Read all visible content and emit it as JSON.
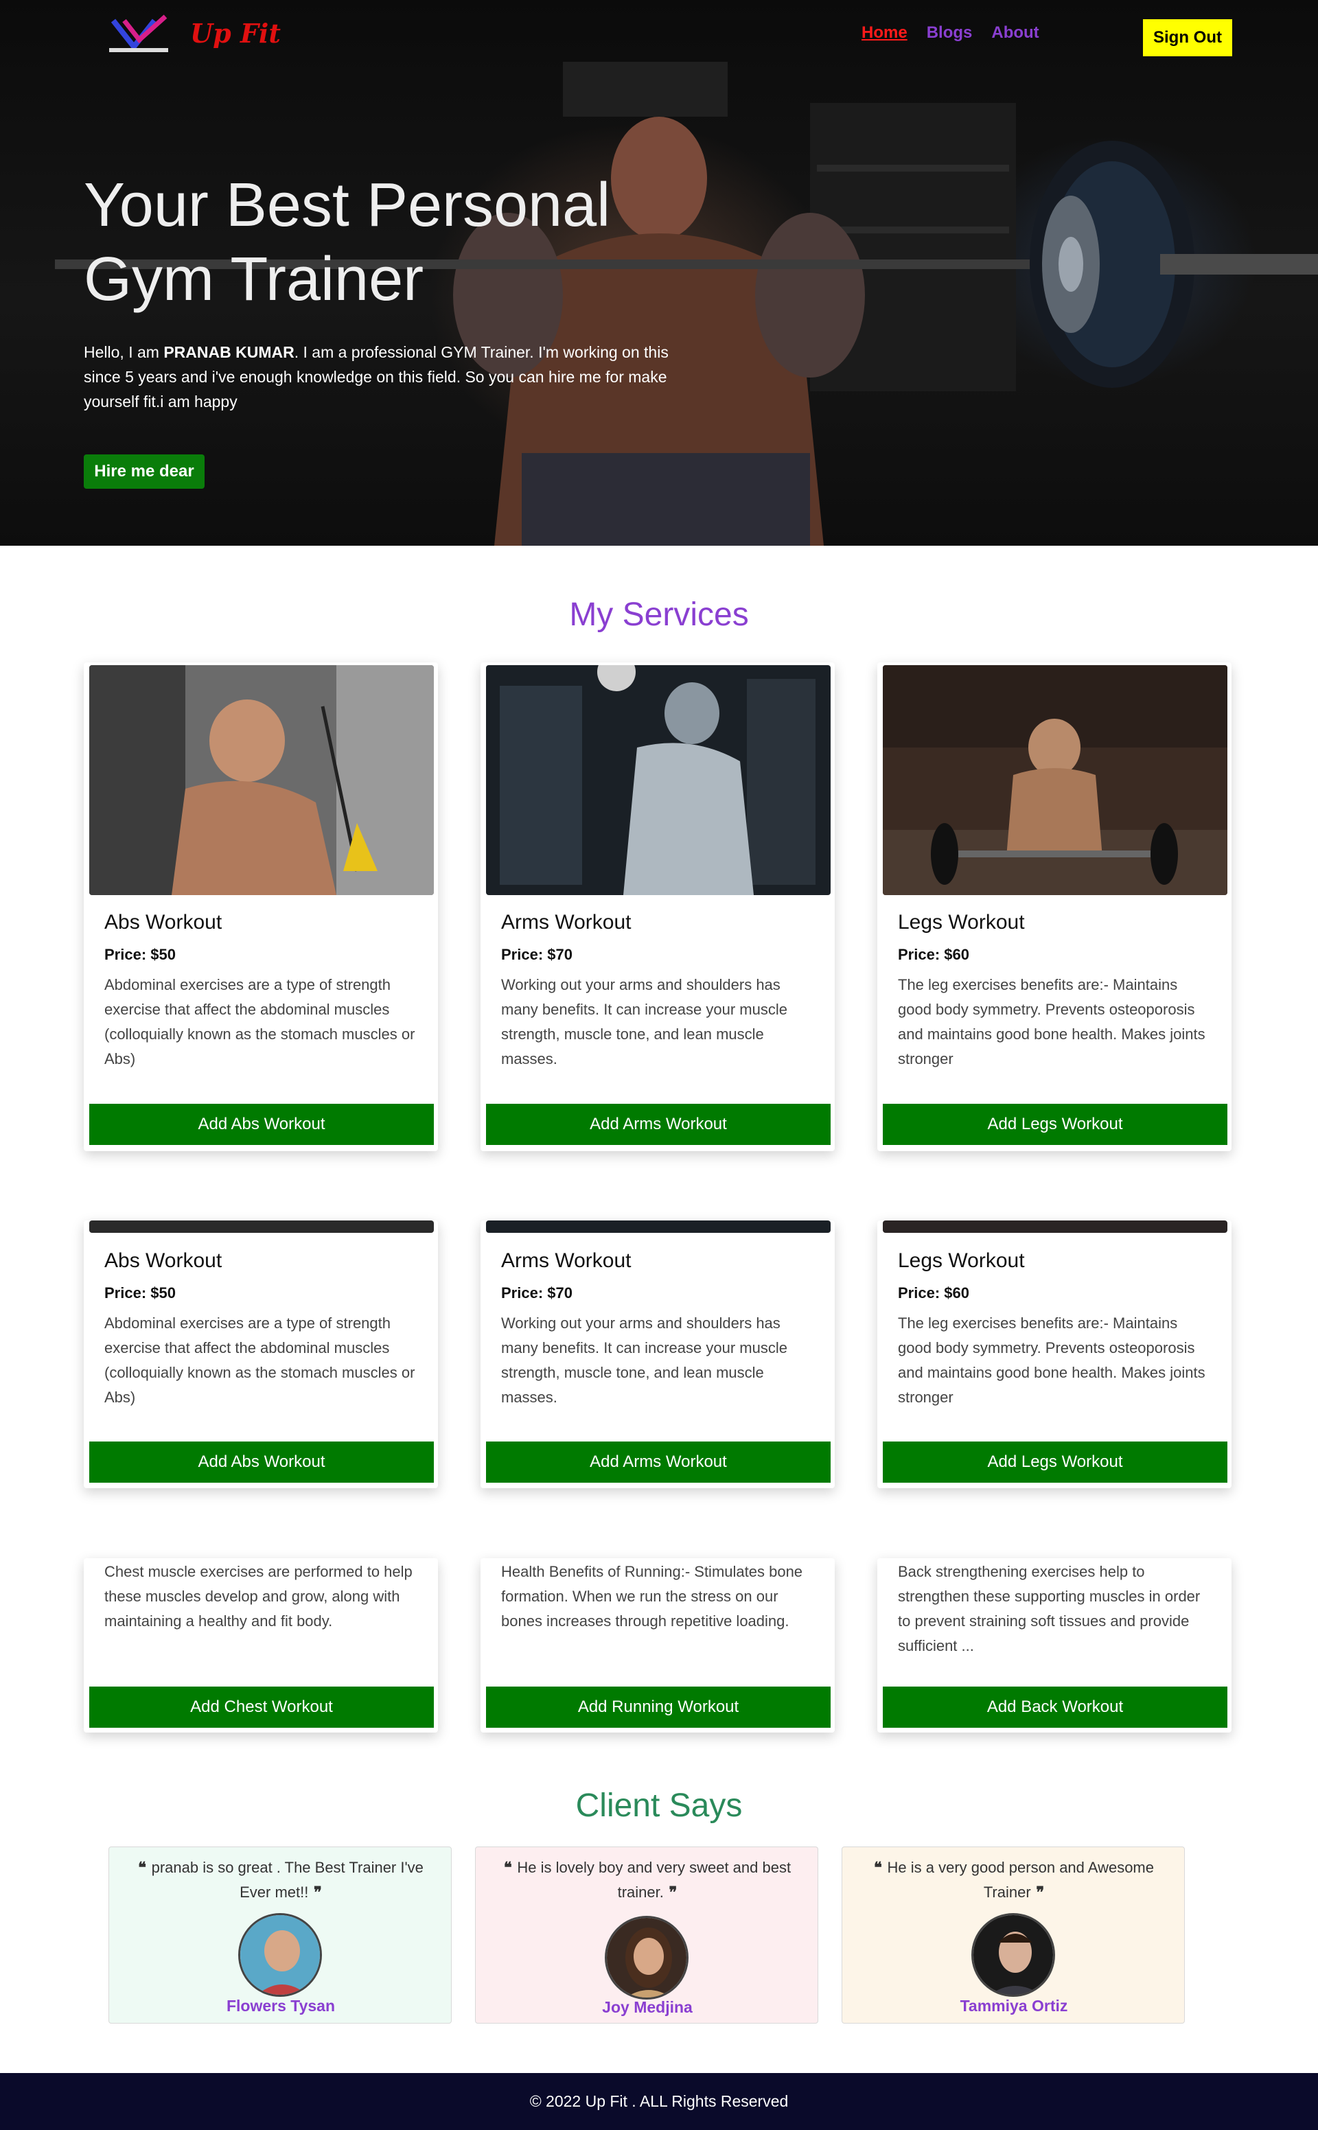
{
  "nav": {
    "brand": "Up Fit",
    "links": [
      "Home",
      "Blogs",
      "About"
    ],
    "signout": "Sign Out"
  },
  "hero": {
    "title_line1": "Your Best Personal",
    "title_line2": "Gym Trainer",
    "text_before": "Hello, I am ",
    "text_name": "PRANAB KUMAR",
    "text_after": ". I am a professional GYM Trainer. I'm working on this since 5 years and i've enough knowledge on this field. So you can hire me for make yourself fit.i am happy",
    "hire_button": "Hire me dear"
  },
  "services": {
    "title": "My Services",
    "row1": [
      {
        "title": "Abs Workout",
        "price": "Price: $50",
        "desc": "Abdominal exercises are a type of strength exercise that affect the abdominal muscles (colloquially known as the stomach muscles or Abs)",
        "button": "Add Abs Workout"
      },
      {
        "title": "Arms Workout",
        "price": "Price: $70",
        "desc": "Working out your arms and shoulders has many benefits. It can increase your muscle strength, muscle tone, and lean muscle masses.",
        "button": "Add Arms Workout"
      },
      {
        "title": "Legs Workout",
        "price": "Price: $60",
        "desc": "The leg exercises benefits are:- Maintains good body symmetry. Prevents osteoporosis and maintains good bone health. Makes joints stronger",
        "button": "Add Legs Workout"
      }
    ],
    "row2": [
      {
        "title": "Abs Workout",
        "price": "Price: $50",
        "desc": "Abdominal exercises are a type of strength exercise that affect the abdominal muscles (colloquially known as the stomach muscles or Abs)",
        "button": "Add Abs Workout"
      },
      {
        "title": "Arms Workout",
        "price": "Price: $70",
        "desc": "Working out your arms and shoulders has many benefits. It can increase your muscle strength, muscle tone, and lean muscle masses.",
        "button": "Add Arms Workout"
      },
      {
        "title": "Legs Workout",
        "price": "Price: $60",
        "desc": "The leg exercises benefits are:- Maintains good body symmetry. Prevents osteoporosis and maintains good bone health. Makes joints stronger",
        "button": "Add Legs Workout"
      }
    ],
    "row3": [
      {
        "desc": "Chest muscle exercises are performed to help these muscles develop and grow, along with maintaining a healthy and fit body.",
        "button": "Add Chest Workout"
      },
      {
        "desc": "Health Benefits of Running:- Stimulates bone formation. When we run the stress on our bones increases through repetitive loading.",
        "button": "Add Running Workout"
      },
      {
        "desc": "Back strengthening exercises help to strengthen these supporting muscles in order to prevent straining soft tissues and provide sufficient ...",
        "button": "Add Back Workout"
      }
    ]
  },
  "clients": {
    "title": "Client Says",
    "items": [
      {
        "quote": "pranab is so great . The Best Trainer I've Ever met!!",
        "name": "Flowers Tysan",
        "bg": "#eefaf4"
      },
      {
        "quote": "He is lovely boy and very sweet and best trainer.",
        "name": "Joy Medjina",
        "bg": "#fdeef0"
      },
      {
        "quote": "He is a very good person and Awesome Trainer",
        "name": "Tammiya Ortiz",
        "bg": "#fdf5e8"
      }
    ]
  },
  "footer": {
    "text": "© 2022 Up Fit . ALL Rights Reserved"
  },
  "colors": {
    "accent_purple": "#8a3fd1",
    "action_green": "#007a00",
    "signout_yellow": "#ffff00",
    "brand_red": "#e01010",
    "footer_bg": "#0a0a2a"
  }
}
